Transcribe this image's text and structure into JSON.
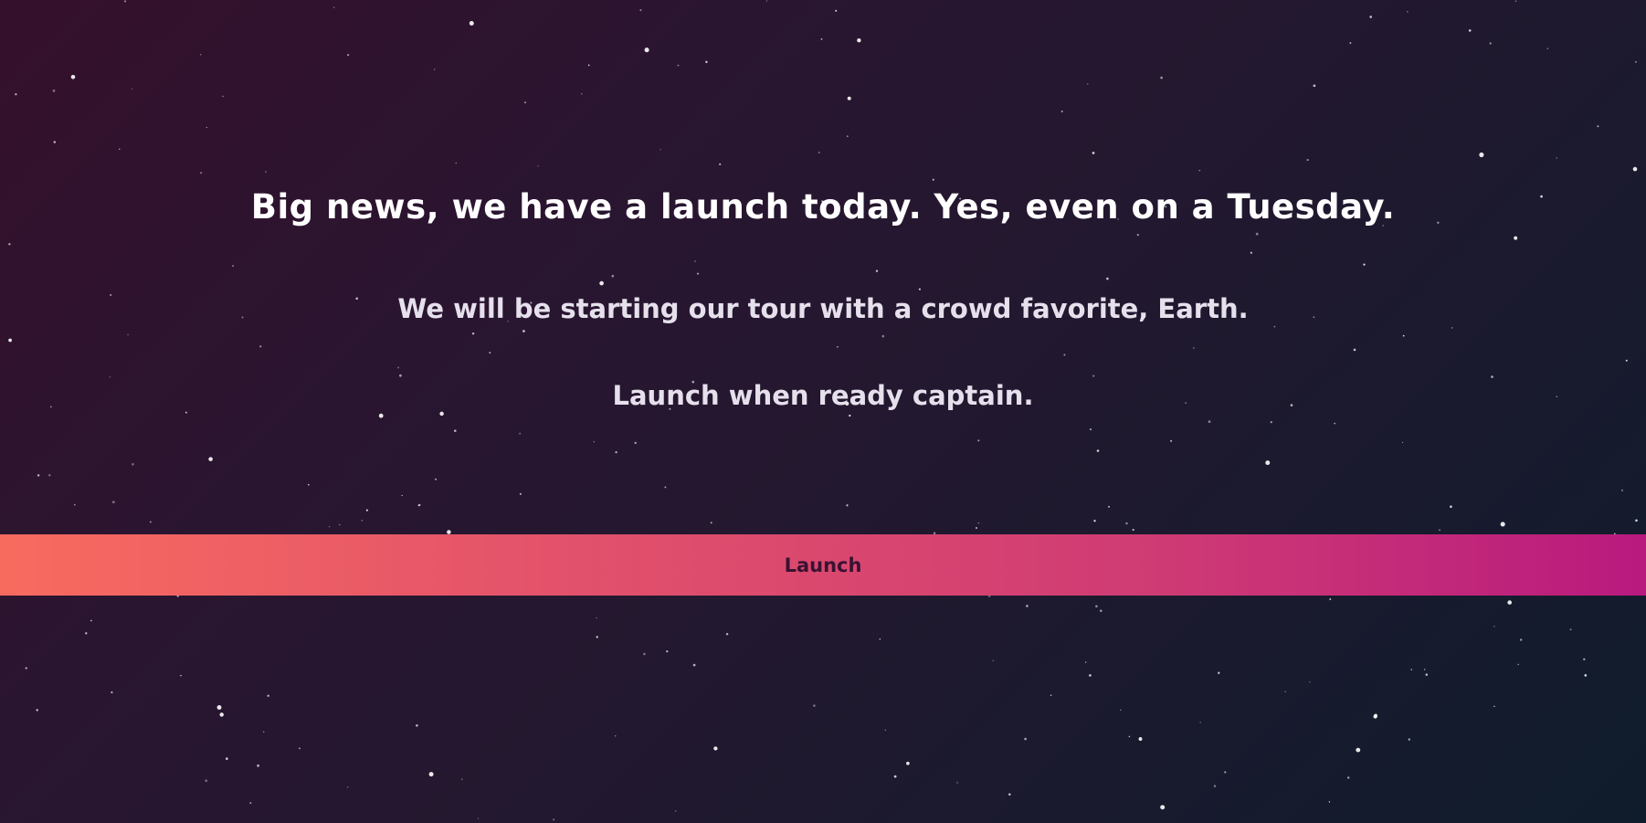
{
  "hero": {
    "headline": "Big news, we have a launch today. Yes, even on a Tuesday.",
    "subline": "We will be starting our tour with a crowd favorite, Earth.",
    "prompt": "Launch when ready captain."
  },
  "actions": {
    "launch_label": "Launch"
  },
  "theme": {
    "background_start": "#35102c",
    "background_end": "#0f1c2c",
    "button_gradient_start": "#f76b5f",
    "button_gradient_end": "#b81a7e",
    "button_text_color": "#3a1232",
    "star_color": "#ffffff"
  }
}
